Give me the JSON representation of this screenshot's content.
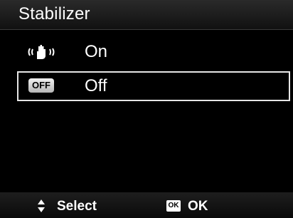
{
  "header": {
    "title": "Stabilizer"
  },
  "menu": {
    "items": [
      {
        "label": "On",
        "icon": "hand-shake-stabilizer-icon",
        "selected": false
      },
      {
        "label": "Off",
        "icon": "off-icon",
        "icon_text": "OFF",
        "selected": true
      }
    ]
  },
  "footer": {
    "navigate_icon": "up-down-arrows-icon",
    "select_label": "Select",
    "ok_icon_text": "OK",
    "ok_label": "OK"
  },
  "colors": {
    "background": "#000000",
    "text": "#ffffff",
    "highlight_border": "#e6e6e6"
  }
}
